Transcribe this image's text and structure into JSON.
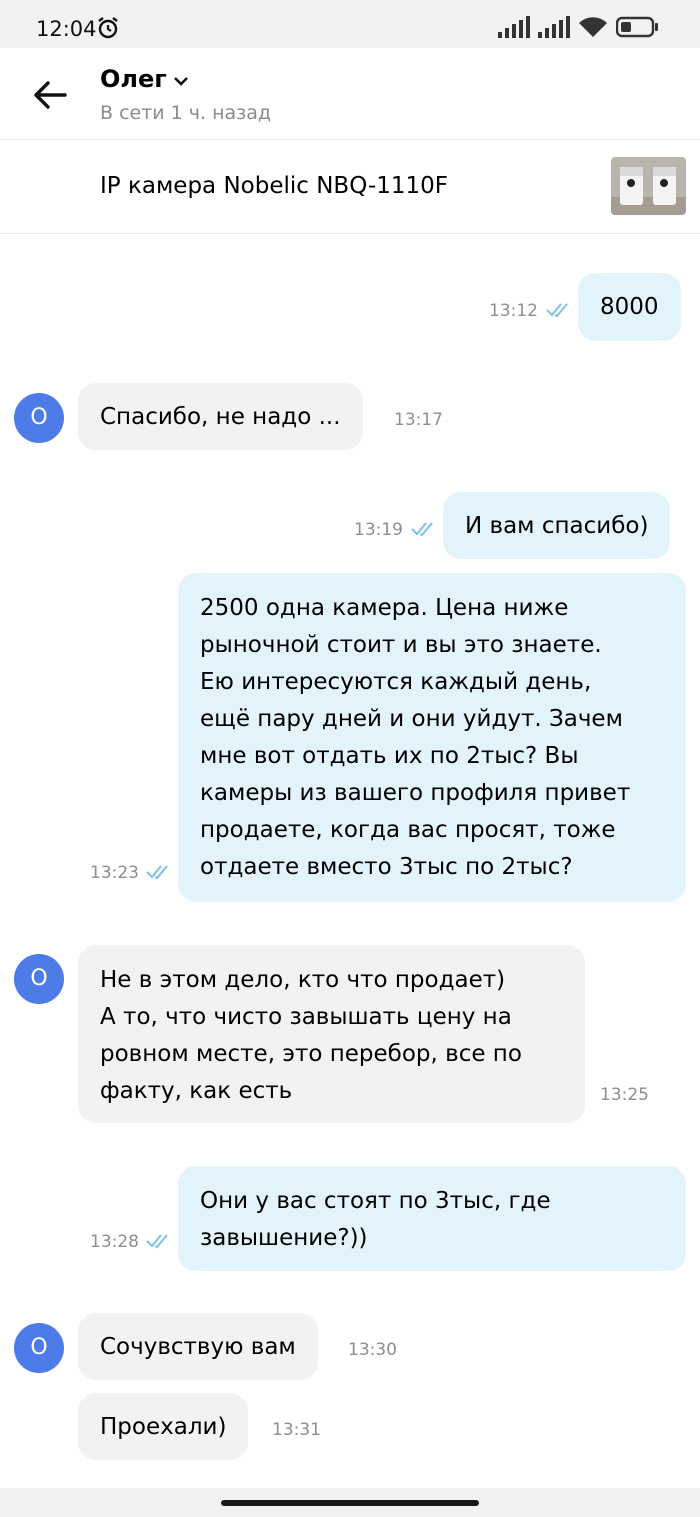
{
  "status_bar": {
    "time": "12:04",
    "alarm_icon": "alarm-icon",
    "signal_icon": "signal-icon",
    "wifi_icon": "wifi-icon",
    "battery_icon": "battery-icon"
  },
  "header": {
    "name": "Олег",
    "status": "В сети 1 ч. назад",
    "back_icon": "arrow-left-icon",
    "dropdown_icon": "chevron-down-icon"
  },
  "item": {
    "title": "IP камера Nobelic NBQ-1110F"
  },
  "avatar_letter": "О",
  "colors": {
    "outgoing_bubble": "#e3f3fb",
    "incoming_bubble": "#f2f2f2",
    "avatar": "#4d7ce8",
    "read_ticks": "#7cc3e6"
  },
  "messages": [
    {
      "direction": "out",
      "text": "8000",
      "time": "13:12"
    },
    {
      "direction": "in",
      "text": "Спасибо, не надо ...",
      "time": "13:17"
    },
    {
      "direction": "out",
      "text": "И вам спасибо)",
      "time": "13:19"
    },
    {
      "direction": "out",
      "lines": [
        "2500 одна камера. Цена ниже",
        "рыночной стоит и вы это знаете.",
        "Ею интересуются каждый день,",
        "ещё пару дней и они уйдут. Зачем",
        "мне вот отдать их по 2тыс? Вы",
        "камеры из вашего профиля привет",
        "продаете, когда вас просят, тоже",
        "отдаете вместо 3тыс по 2тыс?"
      ],
      "time": "13:23"
    },
    {
      "direction": "in",
      "lines": [
        "Не в этом дело, кто что продает)",
        "А то, что чисто завышать цену на",
        "ровном месте,  это перебор, все по",
        "факту, как есть"
      ],
      "time": "13:25"
    },
    {
      "direction": "out",
      "lines": [
        "Они у вас стоят по 3тыс, где",
        "завышение?))"
      ],
      "time": "13:28"
    },
    {
      "direction": "in",
      "text": "Сочувствую вам",
      "time": "13:30"
    },
    {
      "direction": "in",
      "text": "Проехали)",
      "time": "13:31"
    }
  ]
}
